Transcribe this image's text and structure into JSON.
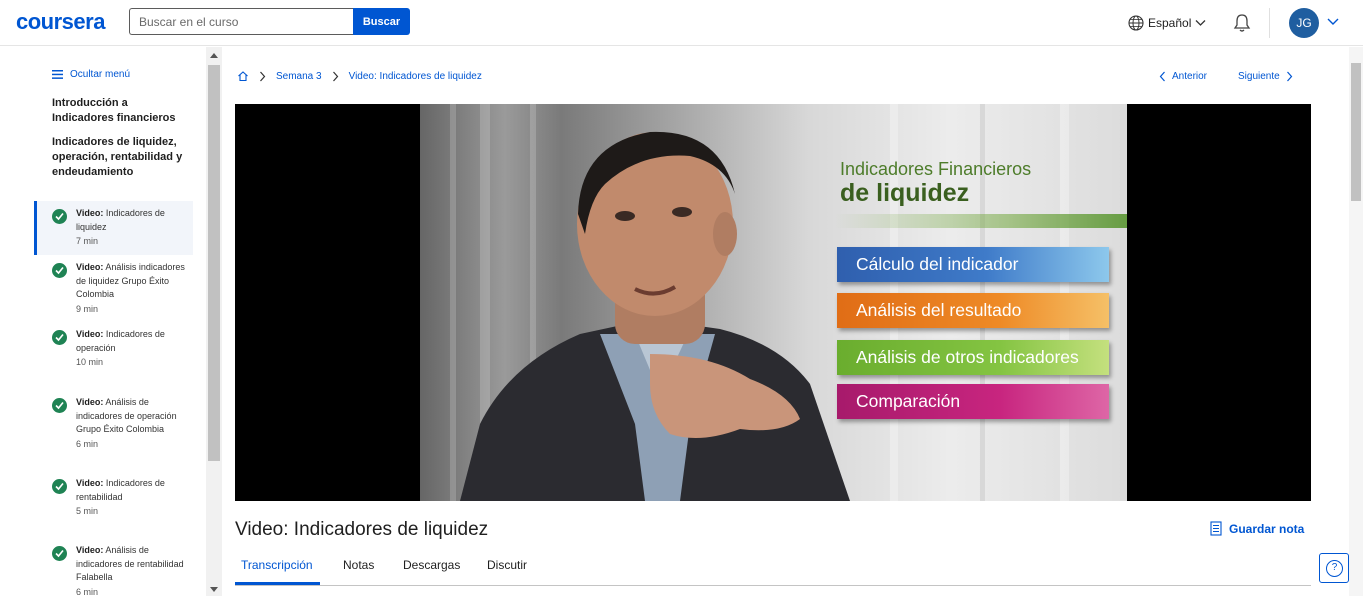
{
  "header": {
    "logo": "coursera",
    "search_placeholder": "Buscar en el curso",
    "search_button": "Buscar",
    "language": "Español",
    "avatar_initials": "JG"
  },
  "sidebar": {
    "hide_menu": "Ocultar menú",
    "module_titles": [
      "Introducción a Indicadores financieros",
      "Indicadores de liquidez, operación, rentabilidad y endeudamiento"
    ],
    "lessons": [
      {
        "type": "Video:",
        "title": "Video: Indicadores de liquidez",
        "duration": "7 min",
        "active": true
      },
      {
        "type": "Video:",
        "title": "Video: Análisis indicadores de liquidez Grupo Éxito Colombia",
        "duration": "9 min"
      },
      {
        "type": "Video:",
        "title": "Video: Indicadores de operación",
        "duration": "10 min"
      },
      {
        "type": "Video:",
        "title": "Video: Análisis de indicadores de operación Grupo Éxito Colombia",
        "duration": "6 min"
      },
      {
        "type": "Video:",
        "title": "Video: Indicadores de rentabilidad",
        "duration": "5 min"
      },
      {
        "type": "Video:",
        "title": "Video: Análisis de indicadores de rentabilidad Falabella",
        "duration": "6 min"
      }
    ]
  },
  "breadcrumb": {
    "week": "Semana 3",
    "current": "Video: Indicadores de liquidez"
  },
  "nav": {
    "prev": "Anterior",
    "next": "Siguiente"
  },
  "video": {
    "slide_title_1": "Indicadores Financieros",
    "slide_title_2": "de liquidez",
    "slide_items": [
      "Cálculo del indicador",
      "Análisis del resultado",
      "Análisis de otros indicadores",
      "Comparación"
    ],
    "slide_colors": [
      "#3b79c6",
      "#e8821e",
      "#7fc241",
      "#c2207a"
    ]
  },
  "main": {
    "title": "Video: Indicadores de liquidez",
    "save_note": "Guardar nota",
    "tabs": [
      "Transcripción",
      "Notas",
      "Descargas",
      "Discutir"
    ]
  },
  "colors": {
    "accent": "#0056d2",
    "check": "#1f8354"
  }
}
